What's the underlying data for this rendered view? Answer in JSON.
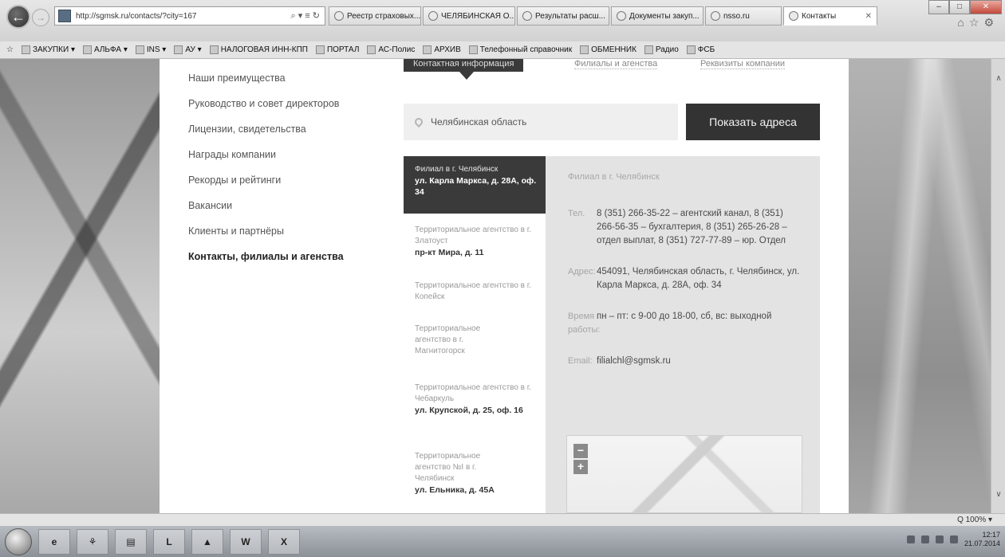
{
  "browser": {
    "url": "http://sgmsk.ru/contacts/?city=167",
    "address_tools": "⌕ ▾ ≡ ↻",
    "tabs": [
      {
        "label": "Реестр страховых...",
        "active": false
      },
      {
        "label": "ЧЕЛЯБИНСКАЯ О...",
        "active": false
      },
      {
        "label": "Результаты расш...",
        "active": false
      },
      {
        "label": "Документы закуп...",
        "active": false
      },
      {
        "label": "nsso.ru",
        "active": false
      },
      {
        "label": "Контакты",
        "active": true
      }
    ],
    "favorites": [
      "ЗАКУПКИ ▾",
      "АЛЬФА ▾",
      "INS ▾",
      "АУ ▾",
      "НАЛОГОВАЯ ИНН-КПП",
      "ПОРТАЛ",
      "АС-Полис",
      "АРХИВ",
      "Телефонный справочник",
      "ОБМЕННИК",
      "Радио",
      "ФСБ"
    ],
    "zoom": "Q 100%  ▾"
  },
  "nav": {
    "items": [
      {
        "label": "Наши преимущества"
      },
      {
        "label": "Руководство и совет директоров"
      },
      {
        "label": "Лицензии, свидетельства"
      },
      {
        "label": "Награды компании"
      },
      {
        "label": "Рекорды и рейтинги"
      },
      {
        "label": "Вакансии"
      },
      {
        "label": "Клиенты и партнёры"
      },
      {
        "label": "Контакты, филиалы и агенства",
        "active": true
      }
    ]
  },
  "page_tabs": [
    {
      "label": "Контактная информация"
    },
    {
      "label": "Филиалы и агенства"
    },
    {
      "label": "Реквизиты компании"
    }
  ],
  "search": {
    "value": "Челябинская область",
    "button": "Показать адреса"
  },
  "agencies": [
    {
      "name": "Филиал в г. Челябинск",
      "address": "ул. Карла Маркса, д. 28А, оф. 34"
    },
    {
      "name": "Территориальное агентство в г. Златоуст",
      "address": "пр-кт Мира, д. 11"
    },
    {
      "name": "Территориальное агентство в г. Копейск",
      "address": ""
    },
    {
      "name": "Территориальное агентство в г. Магнитогорск",
      "address": ""
    },
    {
      "name": "Территориальное агентство в г. Чебаркуль",
      "address": "ул. Крупской, д. 25, оф. 16"
    },
    {
      "name": "Территориальное агентство №I в г. Челябинск",
      "address": "ул. Ельника, д. 45А"
    }
  ],
  "details": {
    "title": "Филиал в г. Челябинск",
    "phone_label": "Тел.",
    "phone": "8 (351) 266-35-22 – агентский канал, 8 (351) 266-56-35 – бухгалтерия, 8 (351) 265-26-28 – отдел выплат, 8 (351) 727-77-89 – юр. Отдел",
    "address_label": "Адрес:",
    "address": "454091, Челябинская область, г. Челябинск, ул. Карла Маркса, д. 28А, оф. 34",
    "hours_label": "Время работы:",
    "hours": "пн – пт: с 9-00 до 18-00, сб, вс: выходной",
    "email_label": "Email:",
    "email": "filialchl@sgmsk.ru"
  },
  "map": {
    "zoom_out": "−",
    "zoom_in": "+"
  },
  "taskbar": {
    "apps": [
      "e",
      "⚘",
      "▤",
      "L",
      "▲",
      "W",
      "X"
    ],
    "time": "12:17",
    "date": "21.07.2014"
  }
}
